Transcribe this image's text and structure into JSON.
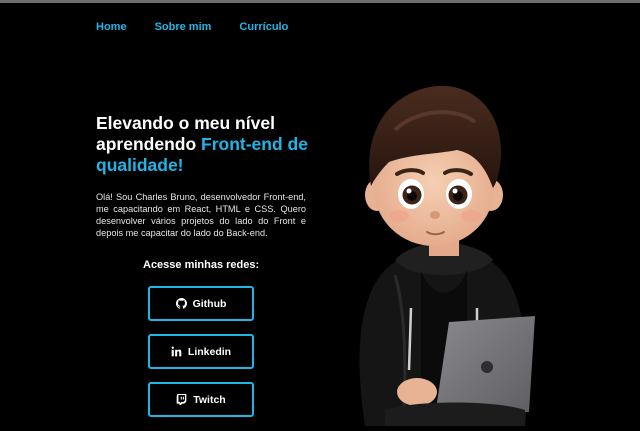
{
  "nav": {
    "home": "Home",
    "about": "Sobre mim",
    "resume": "Currículo"
  },
  "hero": {
    "title_line_1": "Elevando o meu nível",
    "title_line_2a": "aprendendo ",
    "title_highlight": "Front-end de qualidade!"
  },
  "bio": "Olá! Sou Charles Bruno, desenvolvedor Front-end, me capacitando em React, HTML e CSS. Quero desenvolver vários projetos do lado do Front e depois me capacitar do lado do Back-end.",
  "social": {
    "heading": "Acesse minhas redes:",
    "buttons": [
      {
        "label": "Github",
        "icon": "github-icon"
      },
      {
        "label": "Linkedin",
        "icon": "linkedin-icon"
      },
      {
        "label": "Twitch",
        "icon": "twitch-icon"
      }
    ]
  },
  "avatar": {
    "icon": "cartoon-developer-with-laptop"
  },
  "colors": {
    "background": "#000000",
    "accent": "#1eb6e6",
    "text": "#ffffff"
  }
}
